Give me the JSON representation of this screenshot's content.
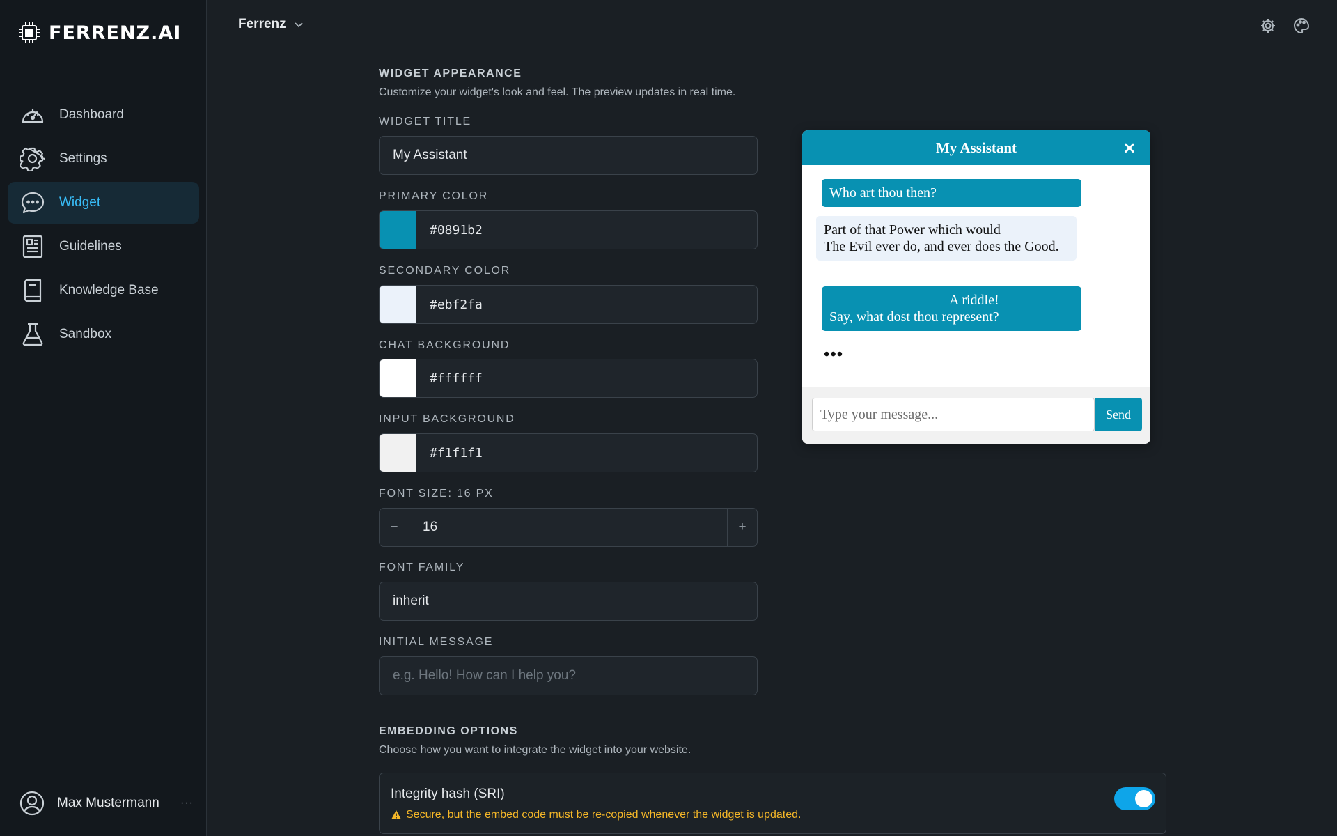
{
  "app": {
    "logo_text": "FERRENZ.AI"
  },
  "sidebar": {
    "items": [
      {
        "label": "Dashboard",
        "icon": "gauge-icon",
        "active": false
      },
      {
        "label": "Settings",
        "icon": "gear-icon",
        "active": false
      },
      {
        "label": "Widget",
        "icon": "chat-bubble-icon",
        "active": true
      },
      {
        "label": "Guidelines",
        "icon": "document-icon",
        "active": false
      },
      {
        "label": "Knowledge Base",
        "icon": "book-icon",
        "active": false
      },
      {
        "label": "Sandbox",
        "icon": "flask-icon",
        "active": false
      }
    ],
    "user": {
      "name": "Max Mustermann",
      "more": "···"
    }
  },
  "topbar": {
    "workspace": "Ferrenz",
    "icons": [
      "settings-icon",
      "palette-icon"
    ]
  },
  "appearance": {
    "title": "WIDGET APPEARANCE",
    "description": "Customize your widget's look and feel. The preview updates in real time.",
    "widget_title": {
      "label": "WIDGET TITLE",
      "value": "My Assistant"
    },
    "primary_color": {
      "label": "PRIMARY COLOR",
      "value": "#0891b2"
    },
    "secondary_color": {
      "label": "SECONDARY COLOR",
      "value": "#ebf2fa"
    },
    "chat_background": {
      "label": "CHAT BACKGROUND",
      "value": "#ffffff"
    },
    "input_background": {
      "label": "INPUT BACKGROUND",
      "value": "#f1f1f1"
    },
    "font_size": {
      "label": "FONT SIZE: 16 PX",
      "value": "16",
      "minus": "−",
      "plus": "+"
    },
    "font_family": {
      "label": "FONT FAMILY",
      "value": "inherit"
    },
    "initial_message": {
      "label": "INITIAL MESSAGE",
      "placeholder": "e.g. Hello! How can I help you?"
    }
  },
  "preview": {
    "title": "My Assistant",
    "close": "×",
    "messages": [
      {
        "role": "user",
        "text": "Who art thou then?"
      },
      {
        "role": "bot",
        "text": "Part of that Power which would\nThe Evil ever do, and ever does the Good."
      },
      {
        "role": "user",
        "text": "A riddle!\nSay, what dost thou represent?"
      }
    ],
    "typing": "•••",
    "input_placeholder": "Type your message...",
    "send_label": "Send"
  },
  "embedding": {
    "title": "EMBEDDING OPTIONS",
    "description": "Choose how you want to integrate the widget into your website.",
    "sri": {
      "title": "Integrity hash (SRI)",
      "warning": "Secure, but the embed code must be re-copied whenever the widget is updated.",
      "enabled": true
    }
  },
  "colors": {
    "accent": "#0ea5e9",
    "active_nav": "#38bdf8",
    "warning": "#f5b728"
  }
}
